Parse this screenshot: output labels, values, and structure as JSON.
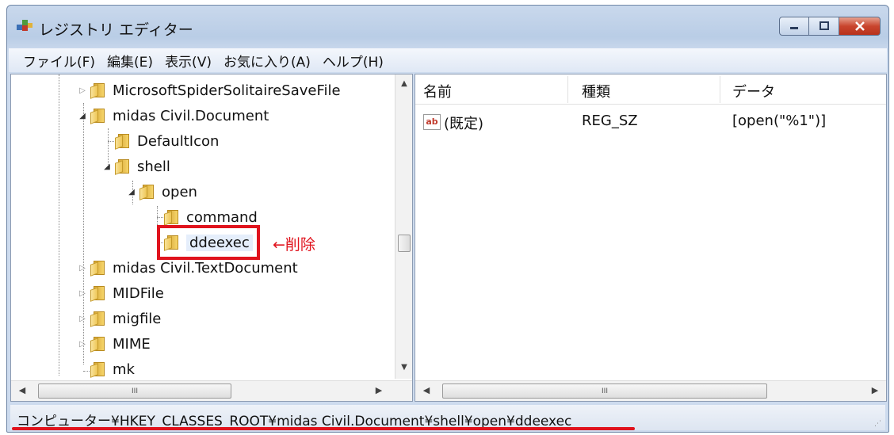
{
  "window": {
    "title": "レジストリ エディター",
    "icon": "registry-editor-icon",
    "buttons": {
      "minimize": "minimize-icon",
      "maximize": "maximize-icon",
      "close": "close-icon"
    },
    "close_color": "#c9452e"
  },
  "menu": [
    "ファイル(F)",
    "編集(E)",
    "表示(V)",
    "お気に入り(A)",
    "ヘルプ(H)"
  ],
  "tree": {
    "items": [
      {
        "label": "MicrosoftSpiderSolitaireSaveFile",
        "expander": "▷"
      },
      {
        "label": "midas Civil.Document",
        "expander": "◢"
      },
      {
        "label": "DefaultIcon",
        "expander": ""
      },
      {
        "label": "shell",
        "expander": "◢"
      },
      {
        "label": "open",
        "expander": "◢"
      },
      {
        "label": "command",
        "expander": ""
      },
      {
        "label": "ddeexec",
        "expander": "",
        "selected": true
      },
      {
        "label": "midas Civil.TextDocument",
        "expander": "▷"
      },
      {
        "label": "MIDFile",
        "expander": "▷"
      },
      {
        "label": "migfile",
        "expander": "▷"
      },
      {
        "label": "MIME",
        "expander": "▷"
      },
      {
        "label": "mk",
        "expander": ""
      }
    ],
    "annotation": "←削除",
    "annotation_color": "#e0131d",
    "scrollbar": {
      "up": "▲",
      "down": "▼",
      "thumb_grip": "III"
    }
  },
  "list": {
    "columns": [
      "名前",
      "種類",
      "データ"
    ],
    "rows": [
      {
        "icon": "string-value-icon",
        "icon_text": "ab",
        "name": "(既定)",
        "type": "REG_SZ",
        "data": "[open(\"%1\")]"
      }
    ],
    "scrollbar": {
      "left": "◀",
      "right": "▶",
      "thumb_grip": "III"
    }
  },
  "status": {
    "path": "コンピューター¥HKEY_CLASSES_ROOT¥midas Civil.Document¥shell¥open¥ddeexec",
    "underline_color": "#e0131d"
  }
}
